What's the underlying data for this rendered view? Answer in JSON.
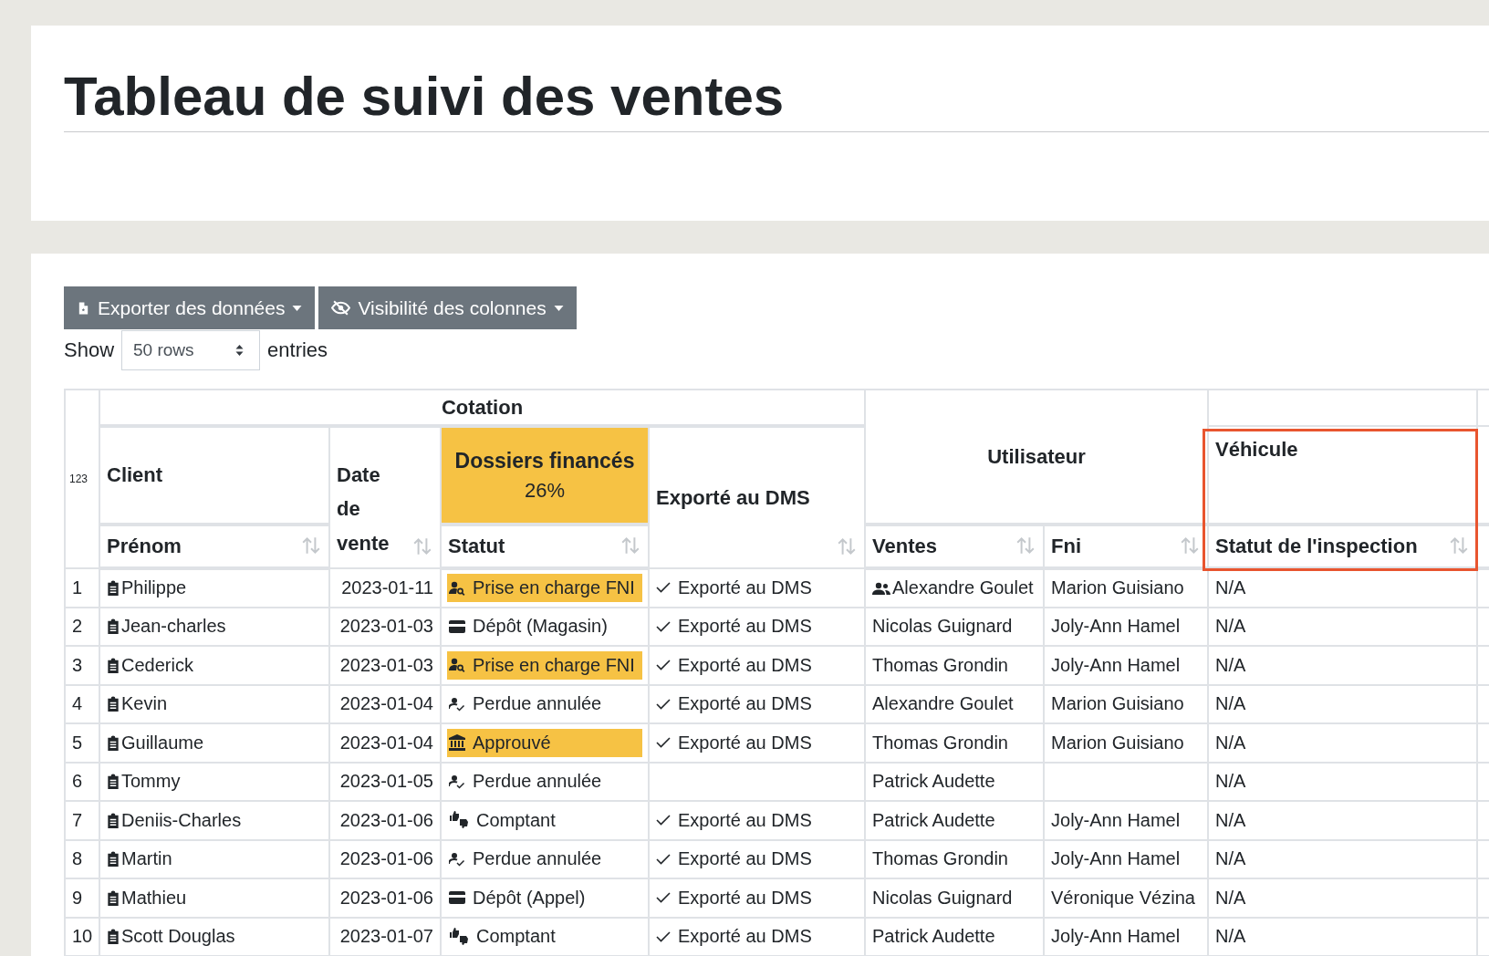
{
  "title": "Tableau de suivi des ventes",
  "toolbar": {
    "buttons": [
      {
        "label": "Exporter des données",
        "kind": "export"
      },
      {
        "label": "Visibilité des colonnes",
        "kind": "visibility"
      }
    ],
    "show_label": "Show",
    "rows_select": "50 rows",
    "entries_label": "entries"
  },
  "table": {
    "index_header": "123",
    "group_headers": {
      "cotation": "Cotation",
      "utilisateur": "Utilisateur"
    },
    "headers": {
      "client": "Client",
      "date": "Date de vente",
      "financed": "Dossiers financés",
      "financed_pct": "26%",
      "exported": "Exporté au DMS",
      "vehicle": "Véhicule"
    },
    "subheaders": {
      "first_name": "Prénom",
      "status": "Statut",
      "sales": "Ventes",
      "fni": "Fni",
      "inspection": "Statut de l'inspection"
    },
    "rows": [
      {
        "index": "1",
        "first_name": "Philippe",
        "date": "2023-01-11",
        "status": {
          "label": "Prise en charge FNI",
          "kind": "review",
          "highlighted": true
        },
        "exported": "Exporté au DMS",
        "sales": "Alexandre Goulet",
        "team": true,
        "fni": "Marion Guisiano",
        "inspection": "N/A"
      },
      {
        "index": "2",
        "first_name": "Jean-charles",
        "date": "2023-01-03",
        "status": {
          "label": "Dépôt (Magasin)",
          "kind": "deposit",
          "highlighted": false
        },
        "exported": "Exporté au DMS",
        "sales": "Nicolas Guignard",
        "team": false,
        "fni": "Joly-Ann Hamel",
        "inspection": "N/A"
      },
      {
        "index": "3",
        "first_name": "Cederick",
        "date": "2023-01-03",
        "status": {
          "label": "Prise en charge FNI",
          "kind": "review",
          "highlighted": true
        },
        "exported": "Exporté au DMS",
        "sales": "Thomas Grondin",
        "team": false,
        "fni": "Joly-Ann Hamel",
        "inspection": "N/A"
      },
      {
        "index": "4",
        "first_name": "Kevin",
        "date": "2023-01-04",
        "status": {
          "label": "Perdue annulée",
          "kind": "lost",
          "highlighted": false
        },
        "exported": "Exporté au DMS",
        "sales": "Alexandre Goulet",
        "team": false,
        "fni": "Marion Guisiano",
        "inspection": "N/A"
      },
      {
        "index": "5",
        "first_name": "Guillaume",
        "date": "2023-01-04",
        "status": {
          "label": "Approuvé",
          "kind": "approved",
          "highlighted": true
        },
        "exported": "Exporté au DMS",
        "sales": "Thomas Grondin",
        "team": false,
        "fni": "Marion Guisiano",
        "inspection": "N/A"
      },
      {
        "index": "6",
        "first_name": "Tommy",
        "date": "2023-01-05",
        "status": {
          "label": "Perdue annulée",
          "kind": "lost",
          "highlighted": false
        },
        "sales": "Patrick Audette",
        "team": false,
        "inspection": "N/A"
      },
      {
        "index": "7",
        "first_name": "Deniis-Charles",
        "date": "2023-01-06",
        "status": {
          "label": "Comptant",
          "kind": "cash",
          "highlighted": false
        },
        "exported": "Exporté au DMS",
        "sales": "Patrick Audette",
        "team": false,
        "fni": "Joly-Ann Hamel",
        "inspection": "N/A"
      },
      {
        "index": "8",
        "first_name": "Martin",
        "date": "2023-01-06",
        "status": {
          "label": "Perdue annulée",
          "kind": "lost",
          "highlighted": false
        },
        "exported": "Exporté au DMS",
        "sales": "Thomas Grondin",
        "team": false,
        "fni": "Joly-Ann Hamel",
        "inspection": "N/A"
      },
      {
        "index": "9",
        "first_name": "Mathieu",
        "date": "2023-01-06",
        "status": {
          "label": "Dépôt (Appel)",
          "kind": "deposit",
          "highlighted": false
        },
        "exported": "Exporté au DMS",
        "sales": "Nicolas Guignard",
        "team": false,
        "fni": "Véronique Vézina",
        "inspection": "N/A"
      },
      {
        "index": "10",
        "first_name": "Scott Douglas",
        "date": "2023-01-07",
        "status": {
          "label": "Comptant",
          "kind": "cash",
          "highlighted": false
        },
        "exported": "Exporté au DMS",
        "sales": "Patrick Audette",
        "team": false,
        "fni": "Joly-Ann Hamel",
        "inspection": "N/A"
      }
    ]
  }
}
